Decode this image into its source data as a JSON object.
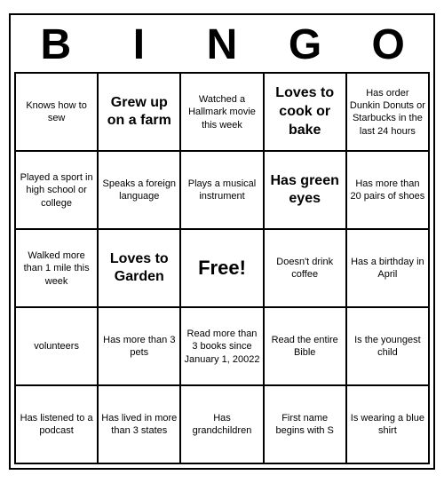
{
  "header": {
    "letters": [
      "B",
      "I",
      "N",
      "G",
      "O"
    ]
  },
  "cells": [
    {
      "id": "r0c0",
      "text": "Knows how to sew",
      "large": false,
      "free": false
    },
    {
      "id": "r0c1",
      "text": "Grew up on a farm",
      "large": true,
      "free": false
    },
    {
      "id": "r0c2",
      "text": "Watched a Hallmark movie this week",
      "large": false,
      "free": false
    },
    {
      "id": "r0c3",
      "text": "Loves to cook or bake",
      "large": true,
      "free": false
    },
    {
      "id": "r0c4",
      "text": "Has order Dunkin Donuts or Starbucks in the last 24 hours",
      "large": false,
      "free": false
    },
    {
      "id": "r1c0",
      "text": "Played a sport in high school or college",
      "large": false,
      "free": false
    },
    {
      "id": "r1c1",
      "text": "Speaks a foreign language",
      "large": false,
      "free": false
    },
    {
      "id": "r1c2",
      "text": "Plays a musical instrument",
      "large": false,
      "free": false
    },
    {
      "id": "r1c3",
      "text": "Has green eyes",
      "large": true,
      "free": false
    },
    {
      "id": "r1c4",
      "text": "Has more than 20 pairs of shoes",
      "large": false,
      "free": false
    },
    {
      "id": "r2c0",
      "text": "Walked more than 1 mile this week",
      "large": false,
      "free": false
    },
    {
      "id": "r2c1",
      "text": "Loves to Garden",
      "large": true,
      "free": false
    },
    {
      "id": "r2c2",
      "text": "Free!",
      "large": false,
      "free": true
    },
    {
      "id": "r2c3",
      "text": "Doesn't drink coffee",
      "large": false,
      "free": false
    },
    {
      "id": "r2c4",
      "text": "Has a birthday in April",
      "large": false,
      "free": false
    },
    {
      "id": "r3c0",
      "text": "volunteers",
      "large": false,
      "free": false
    },
    {
      "id": "r3c1",
      "text": "Has more than 3 pets",
      "large": false,
      "free": false
    },
    {
      "id": "r3c2",
      "text": "Read more than 3 books since January 1, 20022",
      "large": false,
      "free": false
    },
    {
      "id": "r3c3",
      "text": "Read the entire Bible",
      "large": false,
      "free": false
    },
    {
      "id": "r3c4",
      "text": "Is the youngest child",
      "large": false,
      "free": false
    },
    {
      "id": "r4c0",
      "text": "Has listened to a podcast",
      "large": false,
      "free": false
    },
    {
      "id": "r4c1",
      "text": "Has lived in more than 3 states",
      "large": false,
      "free": false
    },
    {
      "id": "r4c2",
      "text": "Has grandchildren",
      "large": false,
      "free": false
    },
    {
      "id": "r4c3",
      "text": "First name begins with S",
      "large": false,
      "free": false
    },
    {
      "id": "r4c4",
      "text": "Is wearing a blue shirt",
      "large": false,
      "free": false
    }
  ]
}
